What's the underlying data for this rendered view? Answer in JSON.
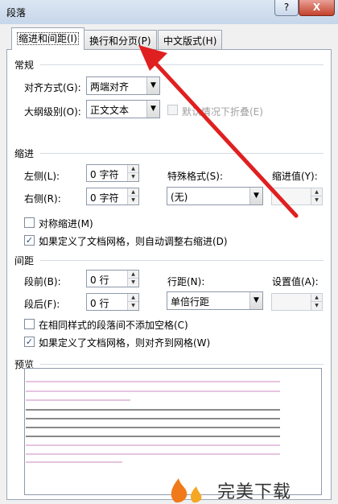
{
  "window": {
    "title": "段落",
    "help_label": "?",
    "close_label": "X"
  },
  "tabs": [
    {
      "label": "缩进和间距(I)",
      "active": true
    },
    {
      "label": "换行和分页(P)",
      "active": false
    },
    {
      "label": "中文版式(H)",
      "active": false
    }
  ],
  "general": {
    "heading": "常规",
    "alignment": {
      "label": "对齐方式(G):",
      "value": "两端对齐"
    },
    "outline": {
      "label": "大纲级别(O):",
      "value": "正文文本"
    },
    "collapse": {
      "label": "默认情况下折叠(E)",
      "checked": false,
      "disabled": true
    }
  },
  "indent": {
    "heading": "缩进",
    "left": {
      "label": "左侧(L):",
      "value": "0 字符"
    },
    "right": {
      "label": "右侧(R):",
      "value": "0 字符"
    },
    "special": {
      "label": "特殊格式(S):",
      "value": "(无)"
    },
    "by": {
      "label": "缩进值(Y):",
      "value": ""
    },
    "mirror": {
      "label": "对称缩进(M)",
      "checked": false
    },
    "auto_adjust": {
      "label": "如果定义了文档网格，则自动调整右缩进(D)",
      "checked": true
    }
  },
  "spacing": {
    "heading": "间距",
    "before": {
      "label": "段前(B):",
      "value": "0 行"
    },
    "after": {
      "label": "段后(F):",
      "value": "0 行"
    },
    "line": {
      "label": "行距(N):",
      "value": "单倍行距"
    },
    "at": {
      "label": "设置值(A):",
      "value": ""
    },
    "no_space_same": {
      "label": "在相同样式的段落间不添加空格(C)",
      "checked": false
    },
    "snap_grid": {
      "label": "如果定义了文档网格，则对齐到网格(W)",
      "checked": true
    }
  },
  "preview": {
    "heading": "预览"
  },
  "watermark": {
    "text": "完美下载"
  },
  "colors": {
    "arrow": "#e02020",
    "accent": "#2b4a7b"
  }
}
